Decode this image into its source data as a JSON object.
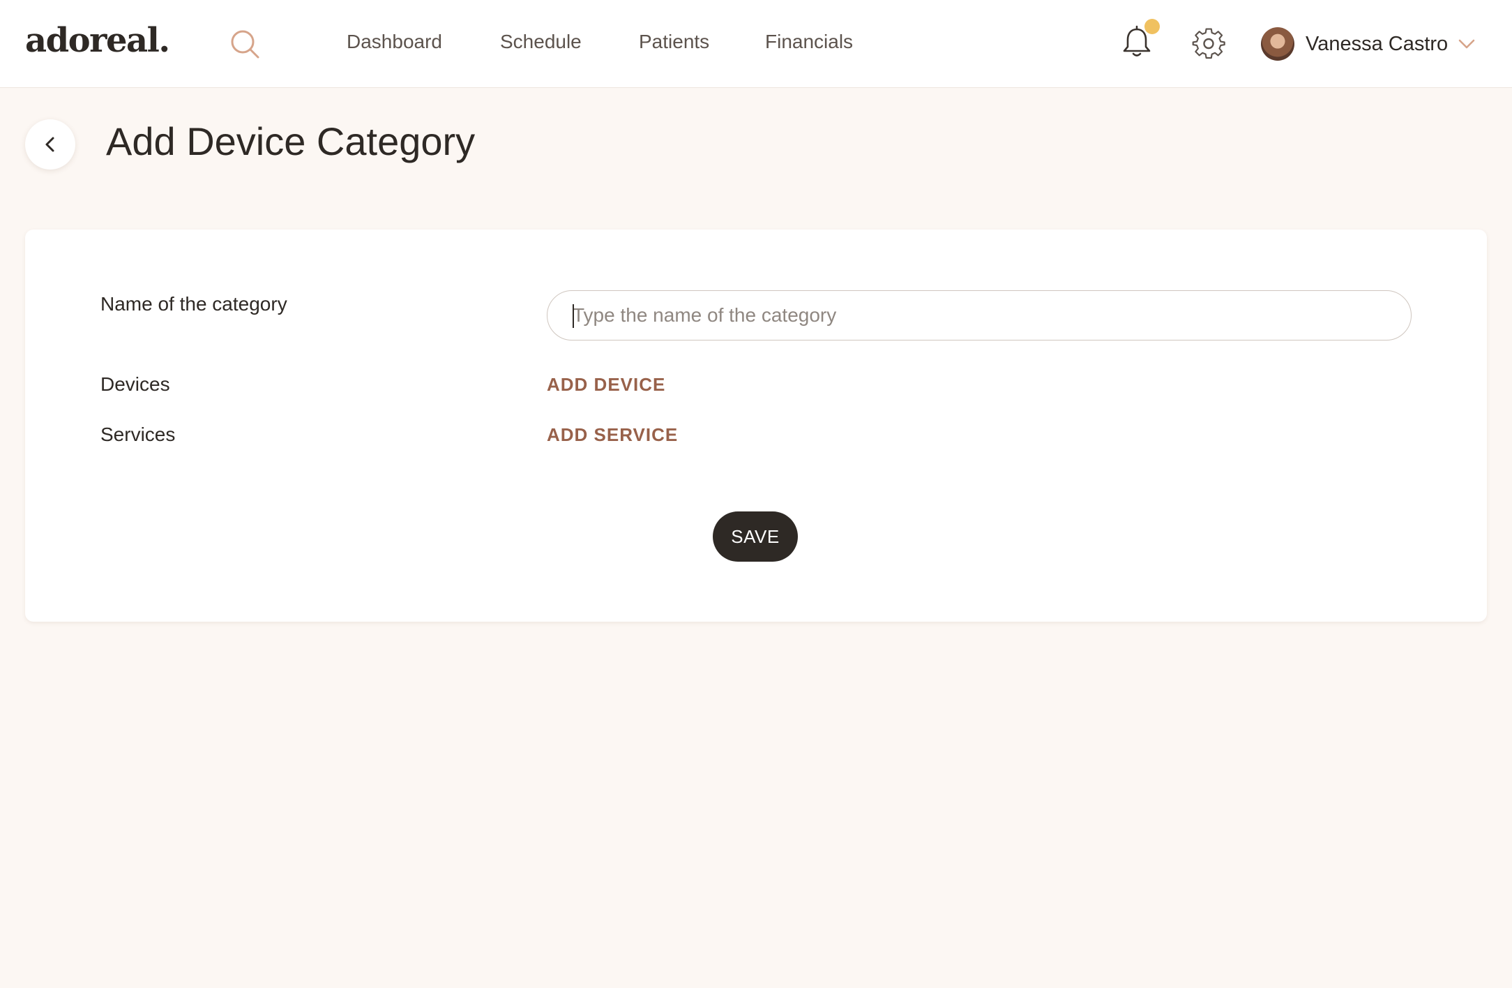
{
  "brand": {
    "logo_text": "adoreal."
  },
  "nav": {
    "items": [
      {
        "label": "Dashboard"
      },
      {
        "label": "Schedule"
      },
      {
        "label": "Patients"
      },
      {
        "label": "Financials"
      }
    ]
  },
  "header_icons": {
    "search": "search-icon",
    "notifications": "bell-icon",
    "notification_dot_color": "#f0c160",
    "settings": "gear-icon"
  },
  "user": {
    "name": "Vanessa Castro"
  },
  "page": {
    "title": "Add Device Category"
  },
  "form": {
    "name_label": "Name of the category",
    "name_value": "",
    "name_placeholder": "Type the name of the category",
    "devices_label": "Devices",
    "add_device_label": "ADD DEVICE",
    "services_label": "Services",
    "add_service_label": "ADD SERVICE",
    "save_label": "SAVE"
  },
  "colors": {
    "background": "#fcf7f3",
    "accent": "#98614a",
    "primary_button": "#2e2925",
    "search_icon": "#d6a48a"
  }
}
